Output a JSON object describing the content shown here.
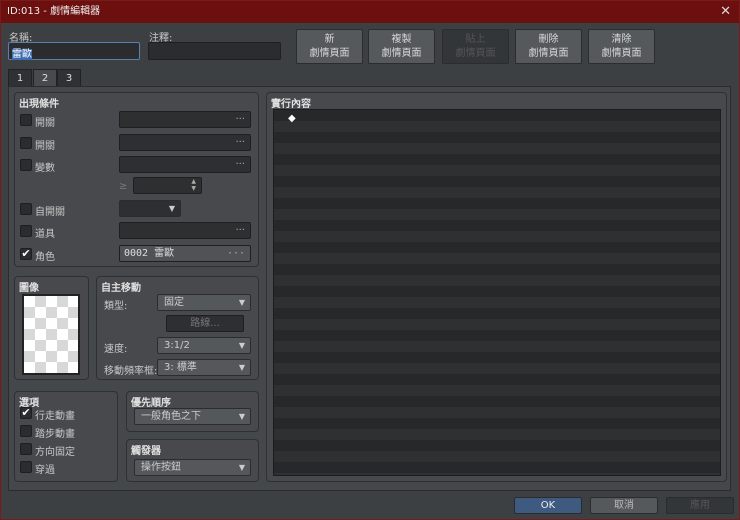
{
  "window": {
    "title": "ID:013 - 劇情編輯器",
    "close": "✕"
  },
  "name": {
    "label": "名稱:",
    "value": "雷歐"
  },
  "note": {
    "label": "注釋:",
    "value": ""
  },
  "page_buttons": [
    {
      "l1": "新",
      "l2": "劇情頁面",
      "enabled": true
    },
    {
      "l1": "複製",
      "l2": "劇情頁面",
      "enabled": true
    },
    {
      "l1": "貼上",
      "l2": "劇情頁面",
      "enabled": false
    },
    {
      "l1": "刪除",
      "l2": "劇情頁面",
      "enabled": true
    },
    {
      "l1": "清除",
      "l2": "劇情頁面",
      "enabled": true
    }
  ],
  "tabs": [
    {
      "label": "1"
    },
    {
      "label": "2",
      "selected": true
    },
    {
      "label": "3"
    }
  ],
  "conditions": {
    "title": "出現條件",
    "rows": [
      {
        "label": "開關",
        "checked": false,
        "value": "",
        "dots": "···"
      },
      {
        "label": "開關",
        "checked": false,
        "value": "",
        "dots": "···"
      },
      {
        "label": "變數",
        "checked": false,
        "value": "",
        "dots": "···"
      },
      {
        "label": "自開關",
        "checked": false,
        "value": ""
      },
      {
        "label": "道具",
        "checked": false,
        "value": "",
        "dots": "···"
      },
      {
        "label": "角色",
        "checked": true,
        "value": "0002 雷歐",
        "dots": "···"
      }
    ],
    "var_op": "≥",
    "var_value": ""
  },
  "image": {
    "title": "圖像"
  },
  "autonomous": {
    "title": "自主移動",
    "type_label": "類型:",
    "type_value": "固定",
    "route_button": "路線...",
    "speed_label": "速度:",
    "speed_value": "3:1/2",
    "freq_label": "移動頻率框:",
    "freq_value": "3: 標準"
  },
  "options": {
    "title": "選項",
    "items": [
      {
        "label": "行走動畫",
        "checked": true
      },
      {
        "label": "踏步動畫",
        "checked": false
      },
      {
        "label": "方向固定",
        "checked": false
      },
      {
        "label": "穿過",
        "checked": false
      }
    ]
  },
  "priority": {
    "title": "優先順序",
    "value": "一般角色之下"
  },
  "trigger": {
    "title": "觸發器",
    "value": "操作按鈕"
  },
  "contents": {
    "title": "實行內容",
    "first_item": "◆"
  },
  "footer": {
    "ok": "OK",
    "cancel": "取消",
    "apply": "應用"
  }
}
